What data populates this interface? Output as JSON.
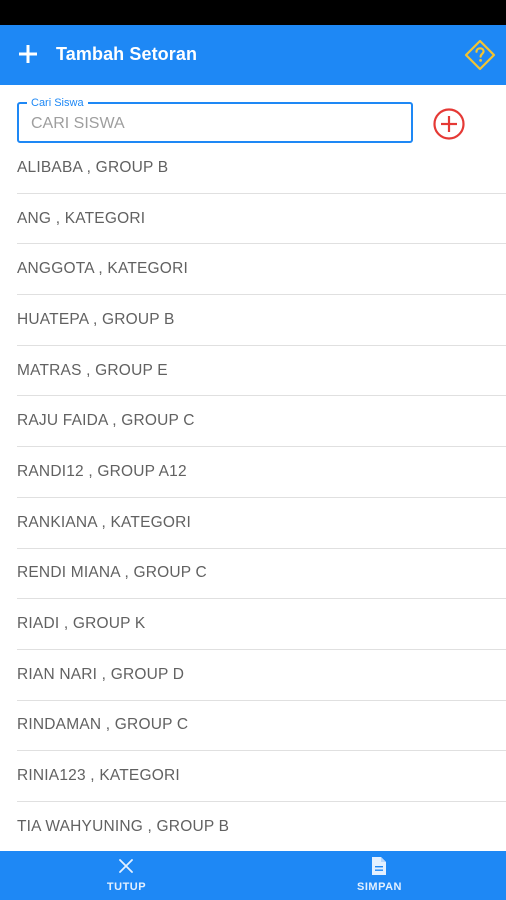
{
  "app_bar": {
    "title": "Tambah Setoran",
    "left_icon": "plus-icon",
    "right_icon": "help-diamond-icon",
    "color": "#1e88f5",
    "help_icon_color": "#f4c430"
  },
  "search": {
    "label": "Cari Siswa",
    "placeholder": "CARI SISWA",
    "value": "",
    "add_icon": "add-circle-icon",
    "add_icon_color": "#e53935"
  },
  "students": [
    {
      "label": "ALIBABA , GROUP B"
    },
    {
      "label": "ANG , KATEGORI"
    },
    {
      "label": "ANGGOTA , KATEGORI"
    },
    {
      "label": "HUATEPA , GROUP B"
    },
    {
      "label": "MATRAS , GROUP E"
    },
    {
      "label": "RAJU FAIDA , GROUP C"
    },
    {
      "label": "RANDI12 , GROUP A12"
    },
    {
      "label": "RANKIANA , KATEGORI"
    },
    {
      "label": "RENDI MIANA , GROUP C"
    },
    {
      "label": "RIADI , GROUP K"
    },
    {
      "label": "RIAN NARI , GROUP D"
    },
    {
      "label": "RINDAMAN , GROUP C"
    },
    {
      "label": "RINIA123 , KATEGORI"
    },
    {
      "label": "TIA WAHYUNING , GROUP B"
    }
  ],
  "bottom_bar": {
    "close": {
      "label": "TUTUP",
      "icon": "close-icon"
    },
    "save": {
      "label": "SIMPAN",
      "icon": "document-icon"
    }
  }
}
